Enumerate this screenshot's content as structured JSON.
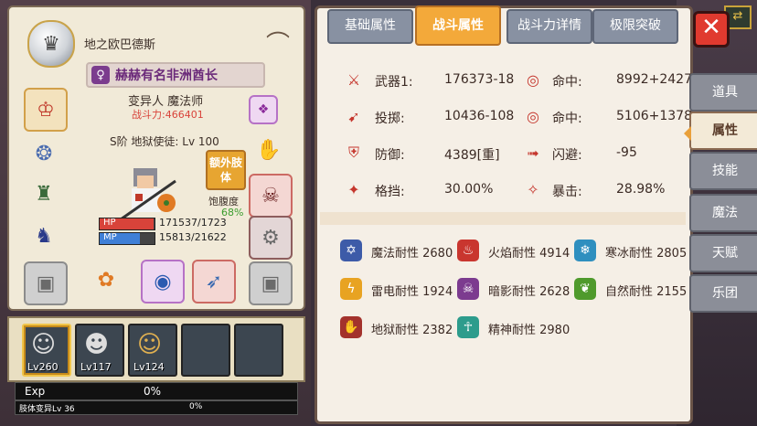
{
  "character": {
    "location": "地之欧巴德斯",
    "title": "赫赫有名非洲酋长",
    "class": "变异人 魔法师",
    "power": "战斗力:466401",
    "tier": "S阶 地狱使徒: Lv 100",
    "extra_limb_btn": "额外肢体",
    "satiety_label": "饱腹度",
    "satiety_value": "68%",
    "hp_label": "HP",
    "hp_text": "171537/1723",
    "hp_fraction": 0.99,
    "mp_label": "MP",
    "mp_text": "15813/21622",
    "mp_fraction": 0.73
  },
  "team": [
    {
      "lv": "Lv260",
      "selected": true
    },
    {
      "lv": "Lv117",
      "selected": false
    },
    {
      "lv": "Lv124",
      "selected": false
    },
    {
      "lv": "",
      "selected": false
    },
    {
      "lv": "",
      "selected": false
    }
  ],
  "exp": {
    "label": "Exp",
    "value": "0%"
  },
  "mutation": {
    "label": "肢体变异Lv 36",
    "value": "0%"
  },
  "tabs": [
    "基础属性",
    "战斗属性",
    "战斗力详情",
    "极限突破"
  ],
  "active_tab": 1,
  "combat_stats": [
    {
      "icon": "sword-icon",
      "label": "武器1:",
      "value": "176373-18",
      "icon2": "target-icon",
      "label2": "命中:",
      "value2": "8992+2427"
    },
    {
      "icon": "bow-icon",
      "label": "投掷:",
      "value": "10436-108",
      "icon2": "target-icon",
      "label2": "命中:",
      "value2": "5106+1378"
    },
    {
      "icon": "shield-icon",
      "label": "防御:",
      "value": "4389[重]",
      "icon2": "dodge-icon",
      "label2": "闪避:",
      "value2": "-95"
    },
    {
      "icon": "block-icon",
      "label": "格挡:",
      "value": "30.00%",
      "icon2": "crit-icon",
      "label2": "暴击:",
      "value2": "28.98%"
    }
  ],
  "resistances": [
    {
      "name": "魔法耐性 2680",
      "icon": "magic-icon",
      "color": "#3d5ba8"
    },
    {
      "name": "火焰耐性 4914",
      "icon": "fire-icon",
      "color": "#c9362f"
    },
    {
      "name": "寒冰耐性 2805",
      "icon": "ice-icon",
      "color": "#2f8fbf"
    },
    {
      "name": "雷电耐性 1924",
      "icon": "lightning-icon",
      "color": "#e8a322"
    },
    {
      "name": "暗影耐性 2628",
      "icon": "shadow-icon",
      "color": "#7c3b8f"
    },
    {
      "name": "自然耐性 2155",
      "icon": "nature-icon",
      "color": "#4f9a2c"
    },
    {
      "name": "地狱耐性 2382",
      "icon": "hell-icon",
      "color": "#a3322c"
    },
    {
      "name": "精神耐性 2980",
      "icon": "spirit-icon",
      "color": "#2d9c8c"
    }
  ],
  "side_nav": [
    "道具",
    "属性",
    "技能",
    "魔法",
    "天赋",
    "乐团"
  ],
  "side_nav_active": 1
}
